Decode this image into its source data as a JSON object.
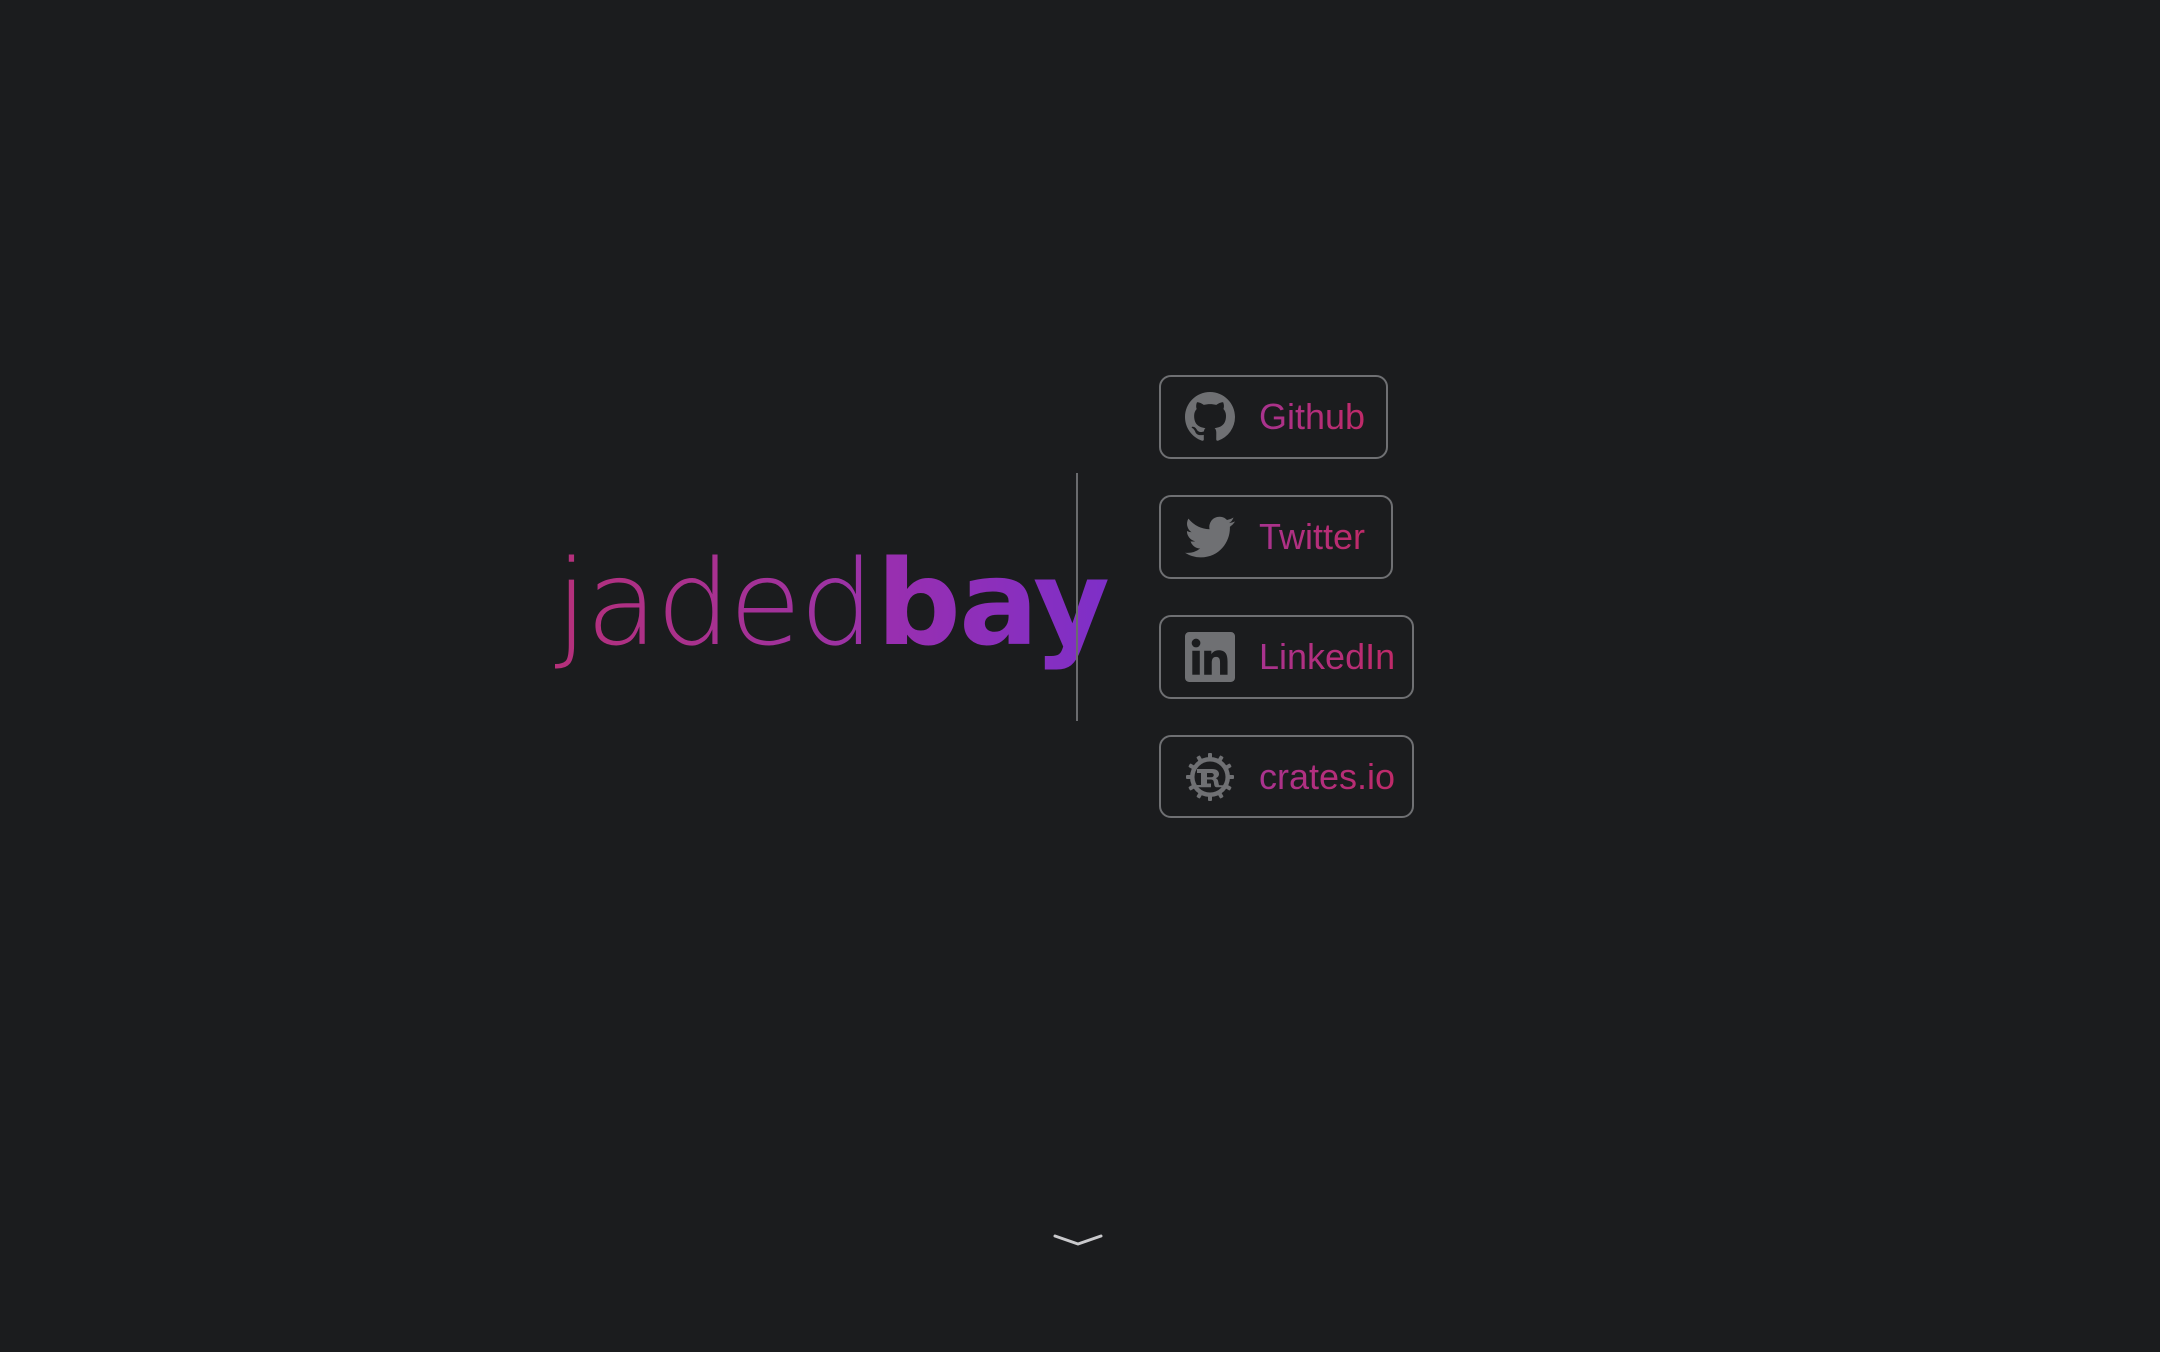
{
  "brand": {
    "name_light": "jaded",
    "name_bold": "bay"
  },
  "links": [
    {
      "label": "Github",
      "icon": "github-icon"
    },
    {
      "label": "Twitter",
      "icon": "twitter-icon"
    },
    {
      "label": "LinkedIn",
      "icon": "linkedin-icon"
    },
    {
      "label": "crates.io",
      "icon": "rust-icon"
    }
  ],
  "scroll": {
    "icon": "chevron-down-icon"
  },
  "colors": {
    "background": "#1b1c1e",
    "accent_pink": "#b5307a",
    "accent_purple": "#8f2fb8",
    "border": "#6f7073",
    "icon": "#6f7073"
  }
}
